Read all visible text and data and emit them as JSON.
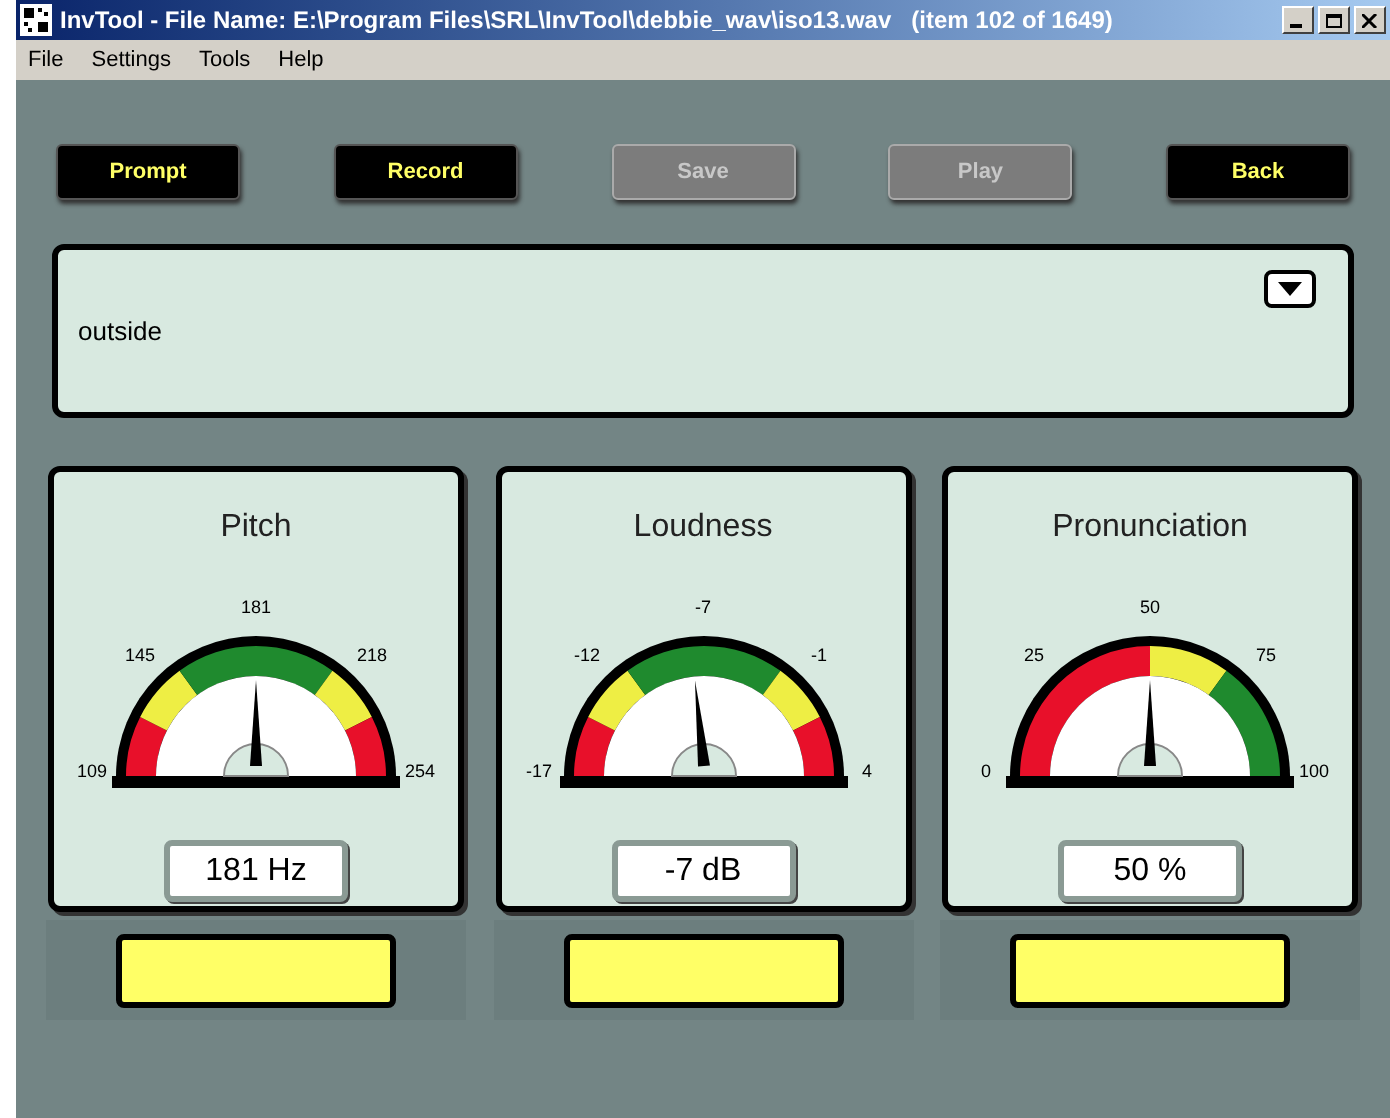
{
  "window": {
    "title": "InvTool - File Name: E:\\Program Files\\SRL\\InvTool\\debbie_wav\\iso13.wav   (item 102 of 1649)"
  },
  "menu": [
    "File",
    "Settings",
    "Tools",
    "Help"
  ],
  "buttons": [
    {
      "label": "Prompt",
      "disabled": false
    },
    {
      "label": "Record",
      "disabled": false
    },
    {
      "label": "Save",
      "disabled": true
    },
    {
      "label": "Play",
      "disabled": true
    },
    {
      "label": "Back",
      "disabled": false
    }
  ],
  "prompt_box": {
    "text": "outside"
  },
  "gauges": [
    {
      "title": "Pitch",
      "kind": "centered",
      "ticks": [
        "109",
        "145",
        "181",
        "218",
        "254"
      ],
      "level": 0.5,
      "reading": "181 Hz"
    },
    {
      "title": "Loudness",
      "kind": "centered",
      "ticks": [
        "-17",
        "-12",
        "-7",
        "-1",
        "4"
      ],
      "level": 0.47,
      "reading": "-7 dB"
    },
    {
      "title": "Pronunciation",
      "kind": "ascending",
      "ticks": [
        "0",
        "25",
        "50",
        "75",
        "100"
      ],
      "level": 0.5,
      "reading": "50 %"
    }
  ]
}
